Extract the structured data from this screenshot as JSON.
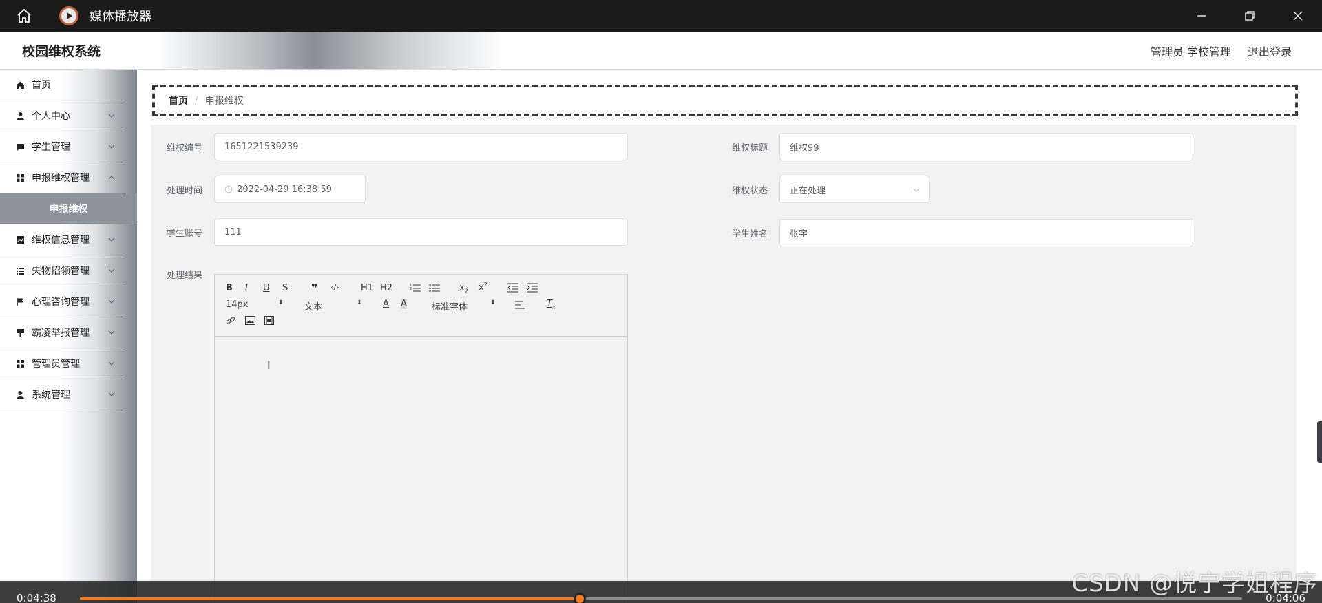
{
  "player": {
    "title": "媒体播放器",
    "time_current": "0:04:38",
    "time_total": "0:04:06",
    "progress": 0.43,
    "accent": "#f47a20"
  },
  "watermark": "CSDN @悦宁学姐程序",
  "header": {
    "brand": "校园维权系统",
    "user": "管理员 学校管理",
    "logout": "退出登录"
  },
  "sidebar": {
    "items": [
      {
        "label": "首页",
        "icon": "home-icon"
      },
      {
        "label": "个人中心",
        "icon": "user-icon"
      },
      {
        "label": "学生管理",
        "icon": "chat-icon"
      },
      {
        "label": "申报维权管理",
        "icon": "grid-icon"
      },
      {
        "label": "申报维权",
        "icon": ""
      },
      {
        "label": "维权信息管理",
        "icon": "chart-icon"
      },
      {
        "label": "失物招领管理",
        "icon": "list-icon"
      },
      {
        "label": "心理咨询管理",
        "icon": "flag-icon"
      },
      {
        "label": "霸凌举报管理",
        "icon": "sign-icon"
      },
      {
        "label": "管理员管理",
        "icon": "grid-icon"
      },
      {
        "label": "系统管理",
        "icon": "user-icon"
      }
    ]
  },
  "breadcrumb": {
    "home": "首页",
    "current": "申报维权"
  },
  "form": {
    "id_label": "维权编号",
    "id_value": "1651221539239",
    "title_label": "维权标题",
    "title_value": "维权99",
    "time_label": "处理时间",
    "time_value": "2022-04-29 16:38:59",
    "status_label": "维权状态",
    "status_value": "正在处理",
    "account_label": "学生账号",
    "account_value": "111",
    "name_label": "学生姓名",
    "name_value": "张宇",
    "result_label": "处理结果"
  },
  "editor": {
    "size": "14px",
    "format": "文本",
    "font": "标准字体",
    "h1": "H1",
    "h2": "H2"
  }
}
